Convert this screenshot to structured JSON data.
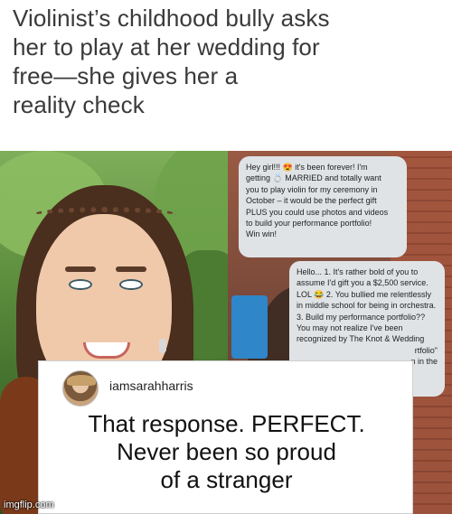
{
  "headline": [
    "Violinist’s childhood bully asks",
    "her to play at her wedding for",
    "free—she gives her a",
    "reality check"
  ],
  "messages": {
    "first": [
      "Hey girl!!! 😍 it's been forever! I'm",
      "getting 💍 MARRIED and totally want",
      "you to play violin for my ceremony in",
      "October – it would be the perfect gift",
      "PLUS you could use photos and videos",
      "to build your performance portfolio!",
      "Win win!"
    ],
    "reply": [
      "Hello... 1. It's rather bold of you to",
      "assume I'd gift you a $2,500 service.",
      "LOL 😂 2. You bullied me relentlessly",
      "in middle school for being in orchestra.",
      "3. Build my performance portfolio??",
      "You may not realize I've been",
      "recognized by The Knot & Wedding",
      "rtfolio\"",
      "n in the"
    ]
  },
  "comment": {
    "username": "iamsarahharris",
    "text": [
      "That response. PERFECT.",
      "Never been so proud",
      "of a stranger"
    ]
  },
  "watermark": "imgflip.com"
}
